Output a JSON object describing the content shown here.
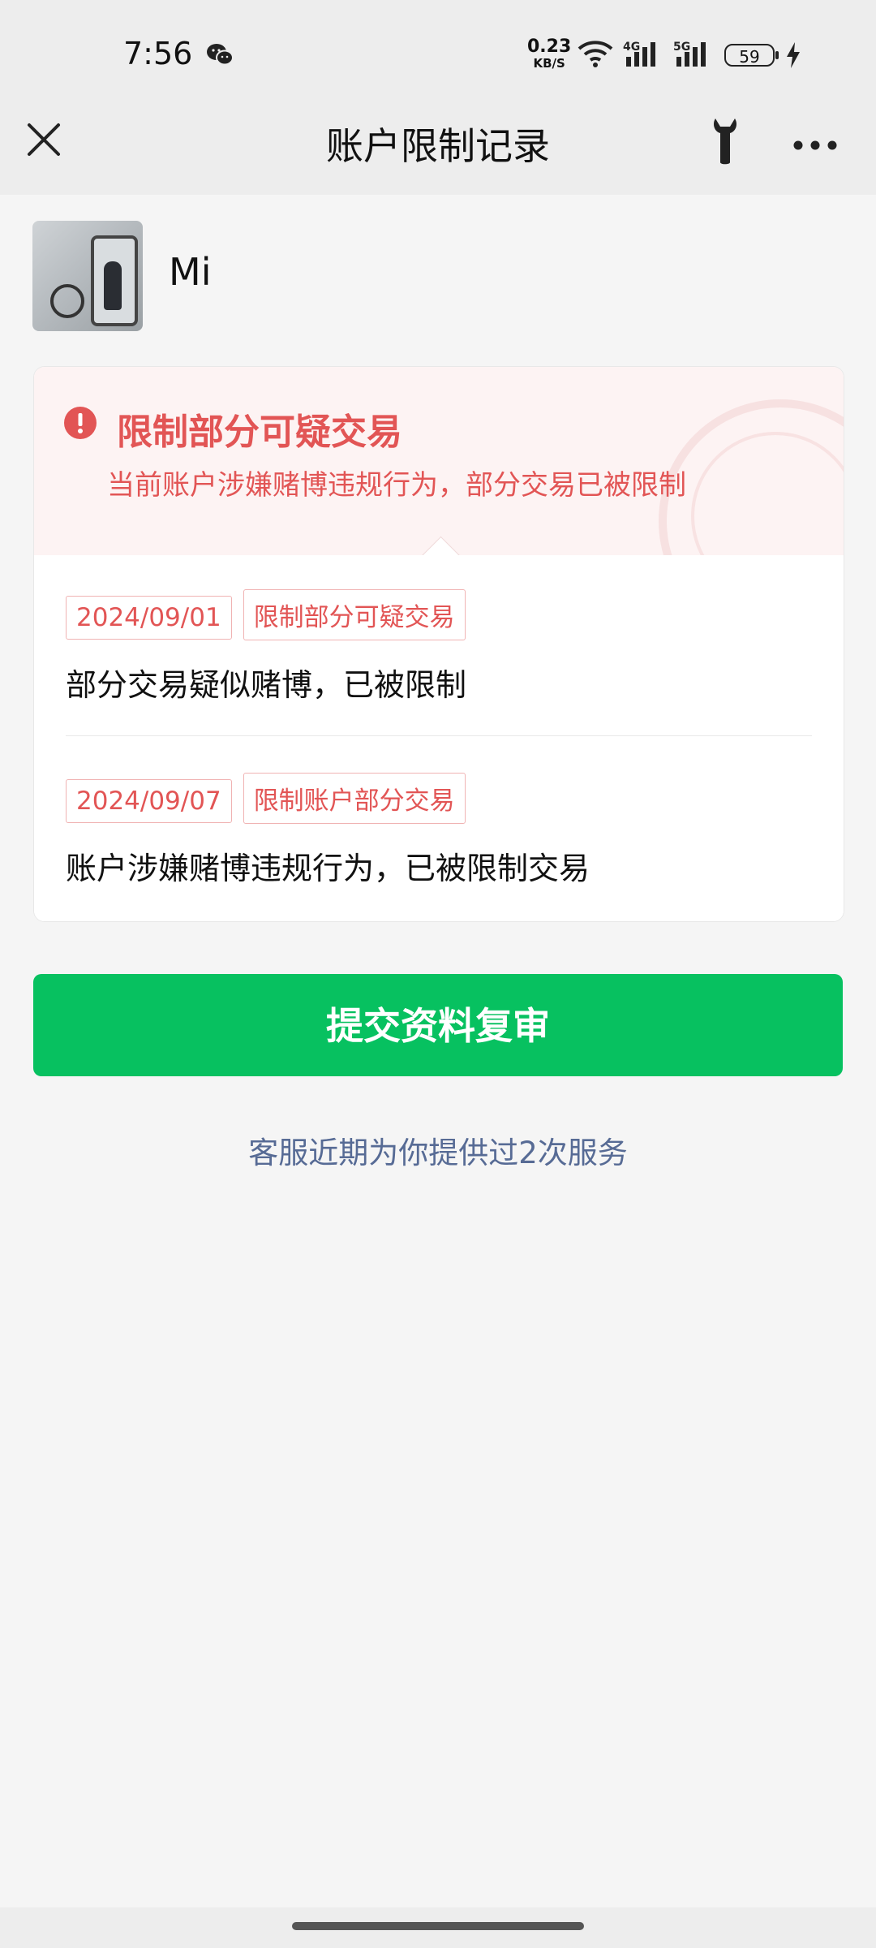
{
  "status_bar": {
    "time": "7:56",
    "net_speed_value": "0.23",
    "net_speed_unit": "KB/S",
    "battery": "59",
    "icons": [
      "wechat-icon",
      "wifi-icon",
      "signal-4g-icon",
      "signal-5g-icon",
      "battery-icon",
      "charging-icon"
    ]
  },
  "nav": {
    "title": "账户限制记录",
    "close_icon": "close-icon",
    "tool_icon": "wrench-icon",
    "more_icon": "more-icon"
  },
  "profile": {
    "name": "Mi"
  },
  "alert": {
    "title": "限制部分可疑交易",
    "subtitle": "当前账户涉嫌赌博违规行为，部分交易已被限制",
    "color": "#e25555"
  },
  "records": [
    {
      "date": "2024/09/01",
      "tag": "限制部分可疑交易",
      "description": "部分交易疑似赌博，已被限制"
    },
    {
      "date": "2024/09/07",
      "tag": "限制账户部分交易",
      "description": "账户涉嫌赌博违规行为，已被限制交易"
    }
  ],
  "actions": {
    "submit_label": "提交资料复审",
    "submit_color": "#07c160",
    "service_text": "客服近期为你提供过2次服务"
  }
}
